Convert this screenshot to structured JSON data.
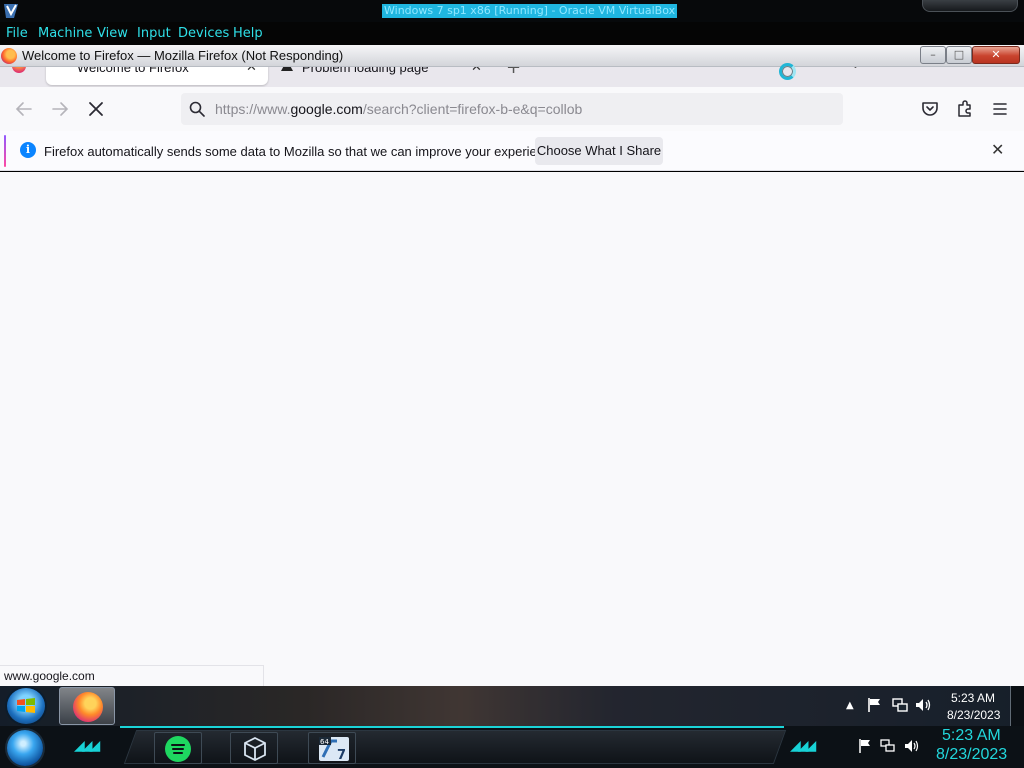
{
  "host": {
    "window_title": "Windows 7 sp1 x86 [Running] - Oracle VM VirtualBox",
    "menu": [
      "File",
      "Machine",
      "View",
      "Input",
      "Devices",
      "Help"
    ],
    "clock": {
      "time": "5:23 AM",
      "date": "8/23/2023"
    }
  },
  "guest_window": {
    "title": "Welcome to Firefox — Mozilla Firefox (Not Responding)",
    "controls": {
      "minimize": "–",
      "maximize": "□",
      "close": "✕"
    }
  },
  "tabs": [
    {
      "label": "Welcome to Firefox",
      "close": "✕",
      "active": true
    },
    {
      "label": "Problem loading page",
      "close": "✕",
      "active": false
    }
  ],
  "new_tab_symbol": "+",
  "tab_list_symbol": "⌄",
  "navbar": {
    "url_host_prefix": "https://www.",
    "url_host": "google.com",
    "url_path": "/search?client=firefox-b-e&q=collob",
    "icons": [
      "back-arrow-icon",
      "forward-arrow-icon",
      "stop-loading-icon",
      "search-icon",
      "pocket-icon",
      "extensions-icon",
      "hamburger-menu-icon"
    ]
  },
  "notification": {
    "info_symbol": "i",
    "text": "Firefox automatically sends some data to Mozilla so that we can improve your experience.",
    "button": "Choose What I Share",
    "close": "✕"
  },
  "status_bar": {
    "text": "www.google.com"
  },
  "guest_taskbar": {
    "tray_arrow": "▲",
    "clock": {
      "time": "5:23 AM",
      "date": "8/23/2023"
    }
  },
  "colors": {
    "host_accent": "#1ad4d8",
    "firefox_link_blue": "#0a84ff",
    "close_red": "#c9442e"
  }
}
